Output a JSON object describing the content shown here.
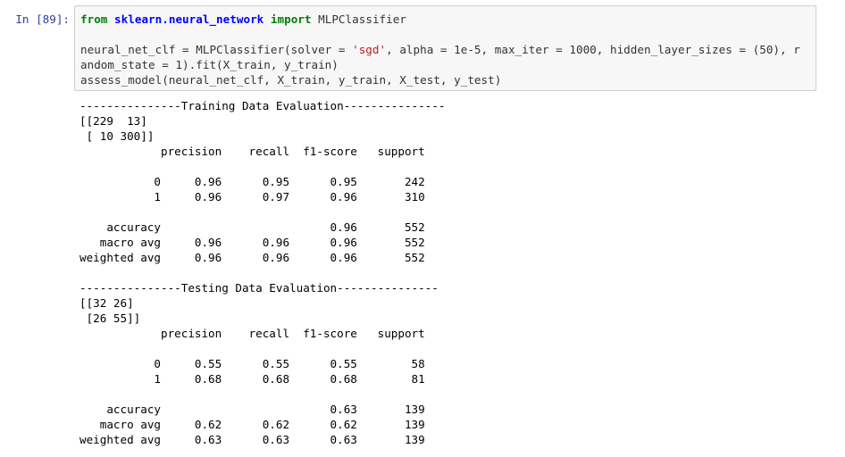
{
  "cell": {
    "prompt": "In [89]:",
    "code": {
      "line1": {
        "from_kw": "from",
        "module": "sklearn.neural_network",
        "import_kw": "import",
        "name": "MLPClassifier"
      },
      "line2": {
        "before_string": "neural_net_clf = MLPClassifier(solver = ",
        "string": "'sgd'",
        "after_string": ", alpha = 1e-5, max_iter = 1000, hidden_layer_sizes = (50), r"
      },
      "line3": "andom_state = 1).fit(X_train, y_train)",
      "line4": "assess_model(neural_net_clf, X_train, y_train, X_test, y_test)"
    },
    "output": {
      "training": {
        "header": "---------------Training Data Evaluation---------------",
        "confusion_matrix": [
          "[[229  13]",
          " [ 10 300]]"
        ],
        "report": {
          "columns": [
            "precision",
            "recall",
            "f1-score",
            "support"
          ],
          "rows": [
            {
              "label": "0",
              "precision": "0.96",
              "recall": "0.95",
              "f1": "0.95",
              "support": "242"
            },
            {
              "label": "1",
              "precision": "0.96",
              "recall": "0.97",
              "f1": "0.96",
              "support": "310"
            },
            {
              "label": "accuracy",
              "precision": "",
              "recall": "",
              "f1": "0.96",
              "support": "552"
            },
            {
              "label": "macro avg",
              "precision": "0.96",
              "recall": "0.96",
              "f1": "0.96",
              "support": "552"
            },
            {
              "label": "weighted avg",
              "precision": "0.96",
              "recall": "0.96",
              "f1": "0.96",
              "support": "552"
            }
          ]
        }
      },
      "testing": {
        "header": "---------------Testing Data Evaluation---------------",
        "confusion_matrix": [
          "[[32 26]",
          " [26 55]]"
        ],
        "report": {
          "columns": [
            "precision",
            "recall",
            "f1-score",
            "support"
          ],
          "rows": [
            {
              "label": "0",
              "precision": "0.55",
              "recall": "0.55",
              "f1": "0.55",
              "support": "58"
            },
            {
              "label": "1",
              "precision": "0.68",
              "recall": "0.68",
              "f1": "0.68",
              "support": "81"
            },
            {
              "label": "accuracy",
              "precision": "",
              "recall": "",
              "f1": "0.63",
              "support": "139"
            },
            {
              "label": "macro avg",
              "precision": "0.62",
              "recall": "0.62",
              "f1": "0.62",
              "support": "139"
            },
            {
              "label": "weighted avg",
              "precision": "0.63",
              "recall": "0.63",
              "f1": "0.63",
              "support": "139"
            }
          ]
        }
      }
    }
  }
}
